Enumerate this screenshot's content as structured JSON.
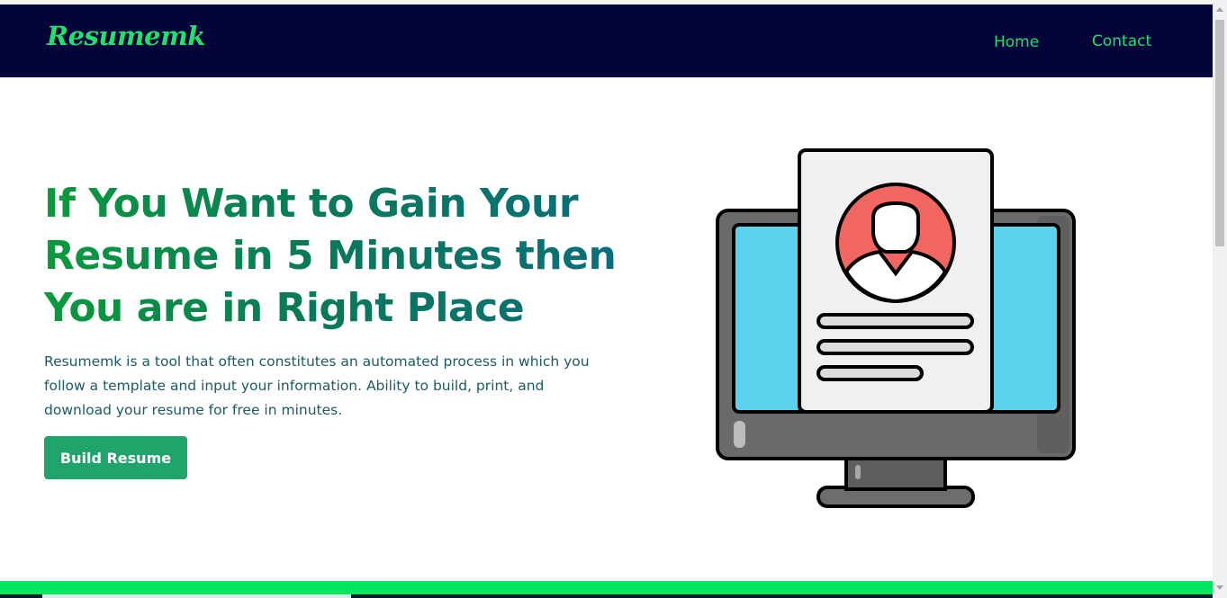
{
  "brand": {
    "logo_text": "Resumemk",
    "accent_color": "#22e06a",
    "nav_bg": "#02043a"
  },
  "nav": {
    "home_label": "Home",
    "contact_label": "Contact"
  },
  "hero": {
    "title_line1": "If You Want to Gain Your",
    "title_line2": "Resume in 5 Minutes then",
    "title_line3": "You are in Right Place",
    "description": "Resumemk is a tool that often constitutes an automated process in which you follow a template and input your information. Ability to build, print, and download your resume for free in minutes.",
    "cta_label": "Build Resume",
    "cta_color": "#1fa56b"
  },
  "illustration": {
    "icon": "monitor-resume-icon"
  }
}
